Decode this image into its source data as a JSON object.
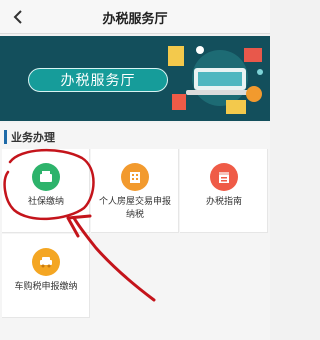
{
  "header": {
    "title": "办税服务厅"
  },
  "banner": {
    "title": "办税服务厅"
  },
  "section": {
    "title": "业务办理"
  },
  "services": [
    {
      "label": "社保缴纳",
      "icon": "wallet-icon",
      "color": "#2db36b"
    },
    {
      "label": "个人房屋交易申报纳税",
      "icon": "building-icon",
      "color": "#f29a2e"
    },
    {
      "label": "办税指南",
      "icon": "calendar-icon",
      "color": "#ef5b47"
    },
    {
      "label": "车购税申报缴纳",
      "icon": "car-icon",
      "color": "#f4a623"
    }
  ],
  "colors": {
    "annotation": "#c4141b",
    "banner_bg": "#134f5c",
    "accent": "#1e6aa8"
  }
}
